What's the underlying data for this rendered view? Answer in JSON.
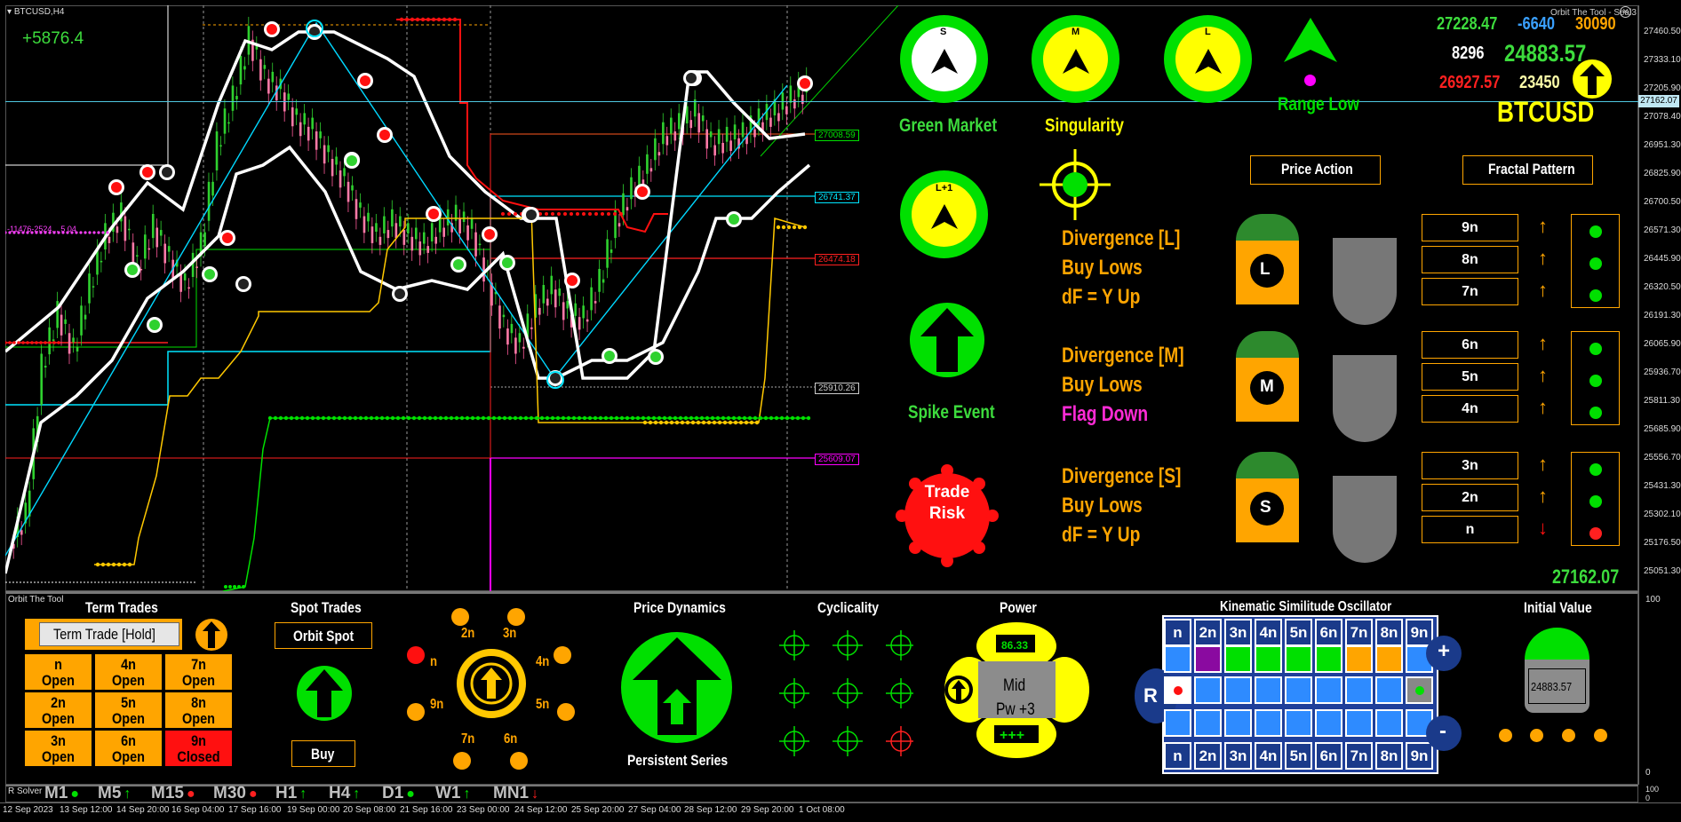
{
  "window": {
    "symbol_tab": "BTCUSD,H4",
    "indicator_title": "Orbit The Tool - Seal3",
    "subwindow_title": "Orbit The Tool",
    "solver_label": "R Solver"
  },
  "chart_data": {
    "type": "candlestick",
    "title": "BTCUSD,H4",
    "xlabel": "",
    "ylabel": "",
    "ylim": [
      25051.3,
      27460.5
    ],
    "y_ticks": [
      "27460.50",
      "27333.10",
      "27205.90",
      "27078.40",
      "26951.30",
      "26825.90",
      "26700.50",
      "26571.30",
      "26445.90",
      "26320.50",
      "26191.30",
      "26065.90",
      "25936.70",
      "25811.30",
      "25685.90",
      "25556.70",
      "25431.30",
      "25302.10",
      "25176.50",
      "25051.30"
    ],
    "x_ticks": [
      "12 Sep 2023",
      "13 Sep 12:00",
      "14 Sep 20:00",
      "16 Sep 04:00",
      "17 Sep 16:00",
      "19 Sep 00:00",
      "20 Sep 08:00",
      "21 Sep 16:00",
      "23 Sep 00:00",
      "24 Sep 12:00",
      "25 Sep 20:00",
      "27 Sep 04:00",
      "28 Sep 12:00",
      "29 Sep 20:00",
      "1 Oct 08:00"
    ],
    "current_price": "27162.07",
    "price_levels": [
      {
        "value": "27008.59",
        "color": "#00e000"
      },
      {
        "value": "26741.37",
        "color": "#00e5ff"
      },
      {
        "value": "26474.18",
        "color": "#ff2020"
      },
      {
        "value": "25910.26",
        "color": "#cccccc"
      },
      {
        "value": "25609.07",
        "color": "#ff00ff"
      }
    ],
    "profit_label": "+5876.4",
    "left_level_label": "-11476-2524... 5 04",
    "close_series": [
      25300,
      25950,
      26180,
      26020,
      26300,
      26520,
      26610,
      26380,
      26560,
      26420,
      26300,
      26480,
      26920,
      27120,
      27380,
      27210,
      27150,
      27020,
      26980,
      26860,
      26760,
      26610,
      26520,
      26580,
      26520,
      26480,
      26560,
      26600,
      26540,
      26320,
      26120,
      26040,
      26210,
      26290,
      26180,
      26160,
      26320,
      26580,
      26720,
      26820,
      26960,
      27000,
      27060,
      26920,
      26940,
      26960,
      27020,
      27060,
      27120,
      27160
    ]
  },
  "stats": {
    "high": "27228.47",
    "diff": "-6640",
    "val3": "30090",
    "val4": "8296",
    "mid": "24883.57",
    "low": "26927.57",
    "val7": "23450",
    "symbol": "BTCUSD",
    "range_label": "Range Low"
  },
  "gauges": {
    "s_label": "S",
    "m_label": "M",
    "l_label": "L",
    "l1_label": "L+1",
    "green_market": "Green Market",
    "singularity": "Singularity",
    "spike_event": "Spike Event",
    "trade_risk": "Trade Risk"
  },
  "sections": {
    "price_action": "Price Action",
    "fractal_pattern": "Fractal Pattern"
  },
  "divergence": [
    {
      "title": "Divergence [L]",
      "line2": "Buy Lows",
      "line3": "dF = Y Up",
      "line3_color": "#ffa500",
      "badge": "L",
      "boxes": [
        "9n",
        "8n",
        "7n"
      ],
      "arrows": [
        "↑",
        "↑",
        "↑"
      ],
      "dots": [
        "#00e000",
        "#00e000",
        "#00e000"
      ]
    },
    {
      "title": "Divergence [M]",
      "line2": "Buy Lows",
      "line3": "Flag Down",
      "line3_color": "#ff2bd6",
      "badge": "M",
      "boxes": [
        "6n",
        "5n",
        "4n"
      ],
      "arrows": [
        "↑",
        "↑",
        "↑"
      ],
      "dots": [
        "#00e000",
        "#00e000",
        "#00e000"
      ]
    },
    {
      "title": "Divergence [S]",
      "line2": "Buy Lows",
      "line3": "dF = Y Up",
      "line3_color": "#ffa500",
      "badge": "S",
      "boxes": [
        "3n",
        "2n",
        "n"
      ],
      "arrows": [
        "↑",
        "↑",
        "↓"
      ],
      "dots": [
        "#00e000",
        "#00e000",
        "#ff2020"
      ]
    }
  ],
  "bottom_price": "27162.07",
  "term_trades": {
    "title": "Term Trades",
    "button": "Term Trade [Hold]",
    "cells": [
      {
        "n": "n",
        "s": "Open"
      },
      {
        "n": "4n",
        "s": "Open"
      },
      {
        "n": "7n",
        "s": "Open"
      },
      {
        "n": "2n",
        "s": "Open"
      },
      {
        "n": "5n",
        "s": "Open"
      },
      {
        "n": "8n",
        "s": "Open"
      },
      {
        "n": "3n",
        "s": "Open"
      },
      {
        "n": "6n",
        "s": "Open"
      },
      {
        "n": "9n",
        "s": "Closed"
      }
    ]
  },
  "spot_trades": {
    "title": "Spot Trades",
    "button": "Orbit Spot",
    "buy": "Buy"
  },
  "cycle_dial": {
    "labels": [
      "n",
      "2n",
      "3n",
      "4n",
      "5n",
      "6n",
      "7n",
      "9n"
    ]
  },
  "price_dynamics": {
    "title": "Price Dynamics",
    "subtitle": "Persistent Series"
  },
  "cyclicality": {
    "title": "Cyclicality"
  },
  "power": {
    "title": "Power",
    "value": "86.33",
    "line1": "Mid",
    "line2": "Pw +3",
    "plus": "+++"
  },
  "kinematic": {
    "title": "Kinematic Similitude Oscillator",
    "headers": [
      "n",
      "2n",
      "3n",
      "4n",
      "5n",
      "6n",
      "7n",
      "8n",
      "9n"
    ],
    "row1": [
      "#2e8bff",
      "#8a0aa0",
      "#00e000",
      "#00e000",
      "#00e000",
      "#00e000",
      "#ffa500",
      "#ffa500",
      "#2e8bff"
    ],
    "plus": "+",
    "minus": "-",
    "r": "R"
  },
  "initial_value": {
    "title": "Initial Value",
    "value": "24883.57"
  },
  "subwindow_axis": [
    "100",
    "0",
    "100",
    "0"
  ],
  "timeframes": [
    {
      "label": "M1",
      "mark": "●",
      "color": "#00e000"
    },
    {
      "label": "M5",
      "mark": "↑",
      "color": "#00e000"
    },
    {
      "label": "M15",
      "mark": "●",
      "color": "#ff2020"
    },
    {
      "label": "M30",
      "mark": "●",
      "color": "#ff2020"
    },
    {
      "label": "H1",
      "mark": "↑",
      "color": "#00e000"
    },
    {
      "label": "H4",
      "mark": "↑",
      "color": "#00e000"
    },
    {
      "label": "D1",
      "mark": "●",
      "color": "#00e000"
    },
    {
      "label": "W1",
      "mark": "↑",
      "color": "#00e000"
    },
    {
      "label": "MN1",
      "mark": "↓",
      "color": "#ff2020"
    }
  ]
}
